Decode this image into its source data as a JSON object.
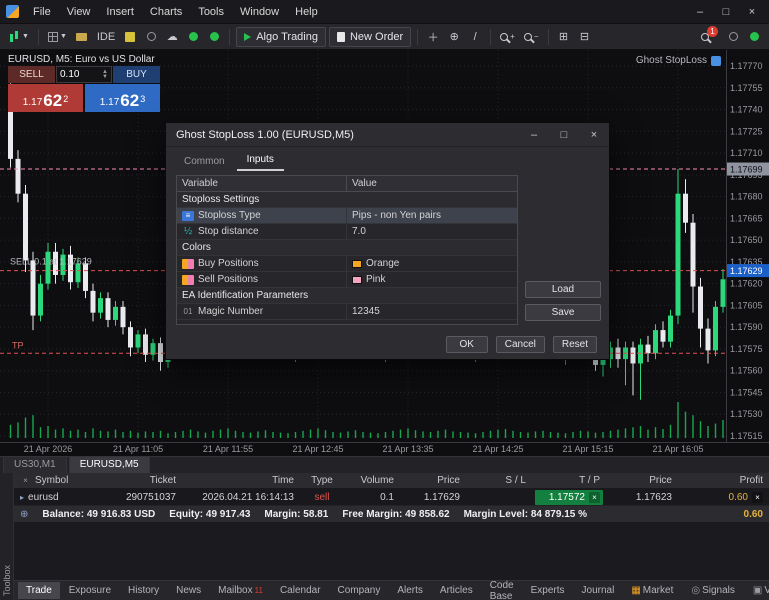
{
  "window": {
    "menus": [
      "File",
      "View",
      "Insert",
      "Charts",
      "Tools",
      "Window",
      "Help"
    ],
    "controls": {
      "minimize": "–",
      "maximize": "□",
      "close": "×"
    }
  },
  "toolbar": {
    "ide_label": "IDE",
    "algo_trading_label": "Algo Trading",
    "new_order_label": "New Order",
    "notification_count": "1"
  },
  "chart": {
    "symbol_label": "EURUSD, M5: Euro vs US Dollar",
    "ea_label": "Ghost StopLoss",
    "one_click": {
      "sell_label": "SELL",
      "buy_label": "BUY",
      "volume": "0.10",
      "bid": {
        "small": "1.17",
        "big": "62",
        "sup": "2"
      },
      "ask": {
        "small": "1.17",
        "big": "62",
        "sup": "3"
      }
    },
    "sell_line_label": "SELL 0.1 at 1.17629",
    "tp_label": "TP",
    "price_axis": [
      "1.17770",
      "1.17755",
      "1.17740",
      "1.17725",
      "1.17710",
      "1.17695",
      "1.17680",
      "1.17665",
      "1.17650",
      "1.17635",
      "1.17620",
      "1.17605",
      "1.17590",
      "1.17575",
      "1.17560",
      "1.17545",
      "1.17530",
      "1.17515"
    ],
    "time_axis": [
      "21 Apr 2026",
      "21 Apr 11:05",
      "21 Apr 11:55",
      "21 Apr 12:45",
      "21 Apr 13:35",
      "21 Apr 14:25",
      "21 Apr 15:15",
      "21 Apr 16:05"
    ],
    "price_boxes": {
      "ghost": "1.17699",
      "open": "1.17629"
    },
    "lines": {
      "ghost_sl": 699,
      "open": 629,
      "tp": 572
    },
    "scale": {
      "top_price": 770,
      "bottom_price": 515
    },
    "candles": [
      [
        740,
        758,
        700,
        706
      ],
      [
        706,
        712,
        676,
        682
      ],
      [
        682,
        688,
        628,
        636
      ],
      [
        636,
        642,
        588,
        598
      ],
      [
        598,
        626,
        594,
        620
      ],
      [
        620,
        648,
        616,
        642
      ],
      [
        642,
        648,
        620,
        626
      ],
      [
        626,
        644,
        622,
        640
      ],
      [
        640,
        646,
        616,
        621
      ],
      [
        621,
        638,
        617,
        634
      ],
      [
        634,
        638,
        610,
        615
      ],
      [
        615,
        620,
        594,
        600
      ],
      [
        600,
        614,
        596,
        610
      ],
      [
        610,
        614,
        590,
        595
      ],
      [
        595,
        608,
        591,
        604
      ],
      [
        604,
        608,
        585,
        590
      ],
      [
        590,
        594,
        570,
        576
      ],
      [
        576,
        588,
        572,
        585
      ],
      [
        585,
        589,
        566,
        571
      ],
      [
        571,
        582,
        567,
        579
      ],
      [
        579,
        583,
        560,
        566
      ],
      [
        566,
        578,
        562,
        574
      ],
      [
        574,
        586,
        570,
        582
      ],
      [
        582,
        594,
        578,
        590
      ],
      [
        590,
        602,
        586,
        598
      ],
      [
        598,
        606,
        588,
        592
      ],
      [
        592,
        598,
        580,
        584
      ],
      [
        584,
        592,
        576,
        588
      ],
      [
        588,
        600,
        584,
        596
      ],
      [
        596,
        608,
        592,
        604
      ],
      [
        604,
        612,
        596,
        600
      ],
      [
        600,
        606,
        588,
        592
      ],
      [
        592,
        596,
        578,
        582
      ],
      [
        582,
        590,
        574,
        586
      ],
      [
        586,
        598,
        582,
        594
      ],
      [
        594,
        602,
        586,
        590
      ],
      [
        590,
        596,
        578,
        582
      ],
      [
        582,
        588,
        570,
        574
      ],
      [
        574,
        582,
        566,
        578
      ],
      [
        578,
        590,
        574,
        586
      ],
      [
        586,
        598,
        582,
        594
      ],
      [
        594,
        606,
        590,
        602
      ],
      [
        602,
        610,
        594,
        598
      ],
      [
        598,
        604,
        586,
        590
      ],
      [
        590,
        596,
        578,
        582
      ],
      [
        582,
        590,
        574,
        586
      ],
      [
        586,
        598,
        582,
        594
      ],
      [
        594,
        602,
        586,
        590
      ],
      [
        590,
        596,
        578,
        582
      ],
      [
        582,
        588,
        570,
        574
      ],
      [
        574,
        582,
        566,
        578
      ],
      [
        578,
        590,
        574,
        586
      ],
      [
        586,
        598,
        582,
        594
      ],
      [
        594,
        606,
        590,
        602
      ],
      [
        602,
        610,
        594,
        598
      ],
      [
        598,
        604,
        586,
        590
      ],
      [
        590,
        596,
        578,
        582
      ],
      [
        582,
        590,
        574,
        586
      ],
      [
        586,
        598,
        582,
        594
      ],
      [
        594,
        602,
        586,
        590
      ],
      [
        590,
        596,
        578,
        582
      ],
      [
        582,
        588,
        570,
        574
      ],
      [
        574,
        582,
        566,
        578
      ],
      [
        578,
        590,
        574,
        586
      ],
      [
        586,
        598,
        582,
        594
      ],
      [
        594,
        606,
        590,
        602
      ],
      [
        602,
        612,
        596,
        608
      ],
      [
        608,
        616,
        600,
        604
      ],
      [
        604,
        610,
        592,
        596
      ],
      [
        596,
        602,
        584,
        588
      ],
      [
        588,
        596,
        580,
        592
      ],
      [
        592,
        600,
        584,
        588
      ],
      [
        588,
        594,
        576,
        580
      ],
      [
        580,
        586,
        568,
        572
      ],
      [
        572,
        580,
        564,
        576
      ],
      [
        576,
        588,
        572,
        584
      ],
      [
        584,
        592,
        576,
        580
      ],
      [
        580,
        586,
        568,
        572
      ],
      [
        572,
        578,
        560,
        564
      ],
      [
        564,
        572,
        556,
        568
      ],
      [
        568,
        580,
        562,
        576
      ],
      [
        576,
        582,
        562,
        568
      ],
      [
        568,
        580,
        550,
        576
      ],
      [
        576,
        580,
        543,
        565
      ],
      [
        565,
        582,
        540,
        578
      ],
      [
        578,
        584,
        566,
        572
      ],
      [
        572,
        592,
        568,
        588
      ],
      [
        588,
        594,
        576,
        580
      ],
      [
        580,
        602,
        576,
        598
      ],
      [
        598,
        699,
        592,
        682
      ],
      [
        682,
        692,
        655,
        662
      ],
      [
        662,
        668,
        600,
        618
      ],
      [
        618,
        624,
        576,
        589
      ],
      [
        589,
        596,
        565,
        574
      ],
      [
        574,
        608,
        570,
        604
      ],
      [
        604,
        630,
        600,
        623
      ]
    ],
    "volumes": [
      22,
      26,
      34,
      38,
      18,
      20,
      14,
      16,
      12,
      14,
      10,
      16,
      12,
      11,
      14,
      10,
      12,
      9,
      11,
      10,
      12,
      8,
      10,
      12,
      14,
      11,
      9,
      12,
      14,
      16,
      12,
      10,
      9,
      11,
      13,
      10,
      9,
      8,
      10,
      12,
      14,
      16,
      13,
      10,
      9,
      11,
      13,
      10,
      9,
      8,
      10,
      12,
      14,
      16,
      13,
      11,
      10,
      12,
      14,
      11,
      10,
      9,
      8,
      10,
      12,
      14,
      15,
      12,
      10,
      9,
      11,
      12,
      10,
      9,
      8,
      10,
      12,
      11,
      9,
      10,
      12,
      14,
      16,
      18,
      20,
      14,
      18,
      15,
      22,
      60,
      44,
      38,
      28,
      20,
      24,
      30
    ]
  },
  "chart_tabs": {
    "tabs": [
      "US30,M1",
      "EURUSD,M5"
    ]
  },
  "dialog": {
    "title": "Ghost StopLoss 1.00 (EURUSD,M5)",
    "tabs": [
      "Common",
      "Inputs"
    ],
    "table": {
      "headers": [
        "Variable",
        "Value"
      ],
      "rows": [
        {
          "type": "group",
          "label": "Stoploss Settings"
        },
        {
          "type": "enum",
          "label": "Stoploss Type",
          "value": "Pips - non Yen pairs"
        },
        {
          "type": "number",
          "label": "Stop distance",
          "value": "7.0"
        },
        {
          "type": "group",
          "label": "Colors"
        },
        {
          "type": "color",
          "label": "Buy Positions",
          "value": "Orange",
          "swatch": "#f5a623"
        },
        {
          "type": "color",
          "label": "Sell Positions",
          "value": "Pink",
          "swatch": "#f3a6c0"
        },
        {
          "type": "group",
          "label": "EA Identification Parameters"
        },
        {
          "type": "number",
          "label": "Magic Number",
          "value": "12345"
        }
      ]
    },
    "buttons": {
      "load": "Load",
      "save": "Save",
      "ok": "OK",
      "cancel": "Cancel",
      "reset": "Reset"
    }
  },
  "toolbox": {
    "vertical_label": "Toolbox",
    "columns": [
      "Symbol",
      "Ticket",
      "Time",
      "Type",
      "Volume",
      "Price",
      "S / L",
      "T / P",
      "Price",
      "Profit"
    ],
    "positions": [
      {
        "symbol": "eurusd",
        "ticket": "290751037",
        "time": "2026.04.21 16:14:13",
        "type": "sell",
        "volume": "0.1",
        "price": "1.17629",
        "sl": "",
        "tp": "1.17572",
        "current": "1.17623",
        "profit": "0.60"
      }
    ],
    "summary": {
      "balance": "Balance: 49 916.83 USD",
      "equity": "Equity: 49 917.43",
      "margin": "Margin: 58.81",
      "free_margin": "Free Margin: 49 858.62",
      "margin_level": "Margin Level: 84 879.15 %",
      "profit": "0.60"
    },
    "tabs": [
      "Trade",
      "Exposure",
      "History",
      "News",
      "Mailbox",
      "Calendar",
      "Company",
      "Alerts",
      "Articles",
      "Code Base",
      "Experts",
      "Journal"
    ],
    "mailbox_badge": "11",
    "right_tabs": [
      "Market",
      "Signals",
      "VPS"
    ]
  },
  "icons": {
    "caret_down": "▼",
    "caret_up": "▲",
    "cloud": "☁",
    "crosshair": "⊕",
    "trendline": "/",
    "tile": "⊞",
    "cascade": "⊟",
    "plus": "+",
    "minus": "−",
    "chevron": "▸",
    "enum": "≡",
    "number": "½",
    "magic": "01",
    "expand": "⊕",
    "close": "×",
    "market": "▦",
    "signals": "◎",
    "vps": "▣"
  },
  "colors": {
    "bull": "#2bd97c",
    "bear": "#e9ebee",
    "volume": "#17a74e",
    "grid": "#26262b",
    "axis_text": "#9a9aa0",
    "line_red": "#e05252",
    "line_pink": "#ff8ab5",
    "box_blue": "#1b5fc9",
    "box_gray": "#9094a0"
  }
}
